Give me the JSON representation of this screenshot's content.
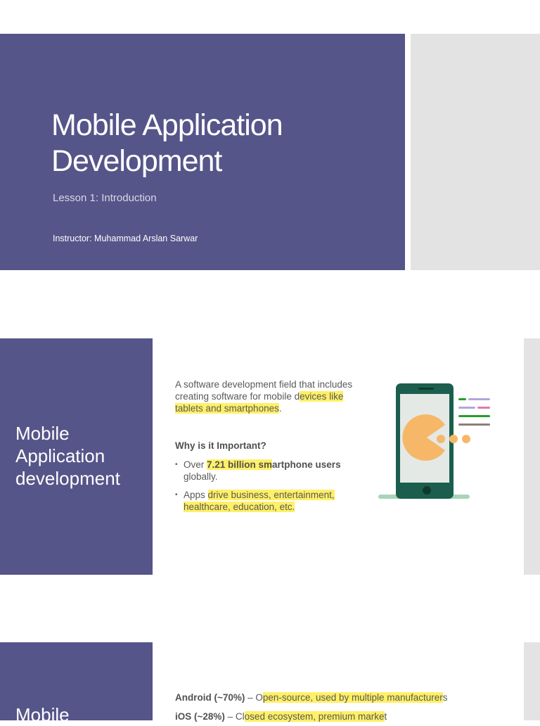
{
  "slide1": {
    "title_line1": "Mobile Application",
    "title_line2": "Development",
    "subtitle": "Lesson 1: Introduction",
    "instructor": "Instructor: Muhammad Arslan Sarwar"
  },
  "slide2": {
    "side_title": [
      "Mobile",
      "Application",
      "development"
    ],
    "intro_pre": "A software development field that includes creating software for mobile d",
    "intro_hl": "evices like tablets and smartphones",
    "intro_post": ".",
    "heading": "Why is it Important?",
    "bullet1_pre": "Over ",
    "bullet1_hl_bold": "7.21 billion sm",
    "bullet1_bold": "artphone users",
    "bullet1_post": " globally.",
    "bullet2_pre": "Apps ",
    "bullet2_hl": "drive business, entertainment, healthcare, education, etc.",
    "illustration": "phone-pacman-icon"
  },
  "slide3": {
    "side_title": "Mobile",
    "android_label": "Android (~70%)",
    "android_sep": " – O",
    "android_hl": "pen-source, used by multiple manufacturer",
    "android_post": "s",
    "ios_label": "iOS (~28%)",
    "ios_sep": " – Cl",
    "ios_hl": "osed ecosystem, premium marke",
    "ios_post": "t"
  },
  "colors": {
    "accent": "#565589",
    "highlight": "#fff066",
    "panel_gray": "#e3e3e3"
  }
}
